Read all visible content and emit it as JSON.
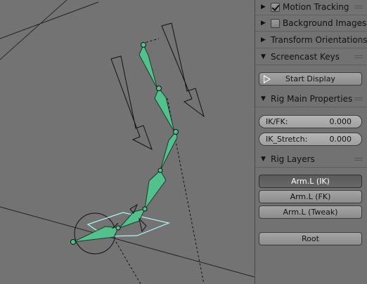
{
  "panels": {
    "motion_tracking": {
      "label": "Motion Tracking",
      "checked": true
    },
    "background_images": {
      "label": "Background Images",
      "checked": false
    },
    "transform_orientations": {
      "label": "Transform Orientations"
    },
    "screencast_keys": {
      "label": "Screencast Keys",
      "button": "Start Display"
    },
    "rig_main_properties": {
      "label": "Rig Main Properties",
      "fields": [
        {
          "name": "IK/FK:",
          "value": "0.000"
        },
        {
          "name": "IK_Stretch:",
          "value": "0.000"
        }
      ]
    },
    "rig_layers": {
      "label": "Rig Layers",
      "buttons": [
        "Arm.L (IK)",
        "Arm.L (FK)",
        "Arm.L (Tweak)"
      ],
      "root": "Root"
    }
  },
  "colors": {
    "viewport_bg": "#737373",
    "bone_fill": "#52c28c",
    "bone_selected_outline": "#aef7f0"
  }
}
